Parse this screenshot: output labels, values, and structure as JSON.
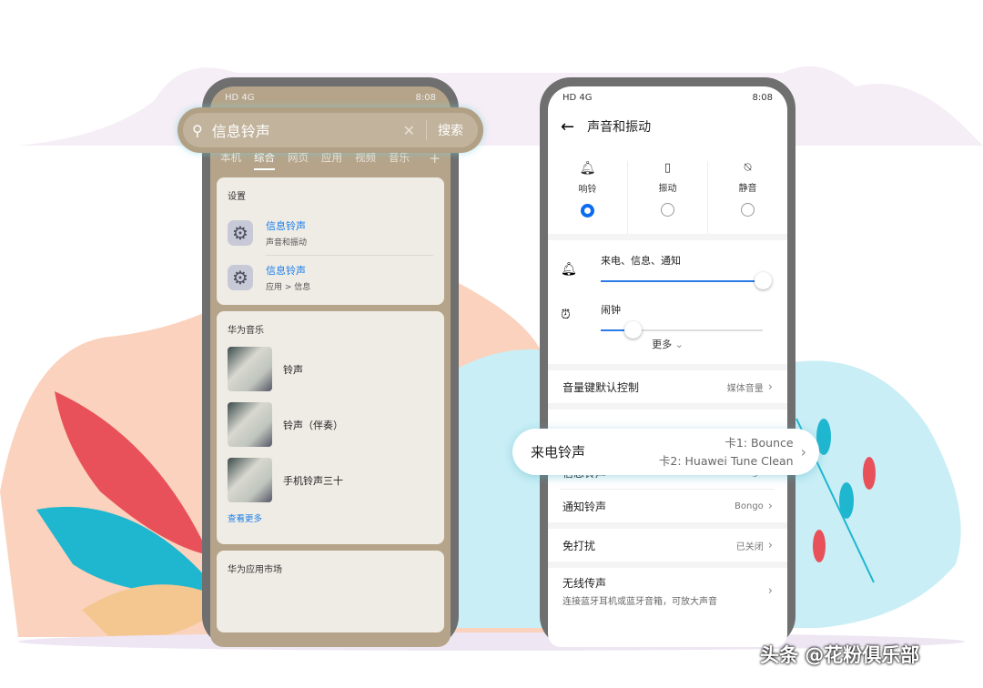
{
  "colors": {
    "accent": "#0a6cf0",
    "link": "#1a7ee8",
    "frame": "#6f6f6f",
    "search_bg": "#b5a48a"
  },
  "status": {
    "left": "HD 4G",
    "time": "8:08"
  },
  "search": {
    "query": "信息铃声",
    "button": "搜索",
    "tabs": [
      "本机",
      "综合",
      "网页",
      "应用",
      "视频",
      "音乐"
    ],
    "active_tab": "综合",
    "add": "+"
  },
  "settings_card": {
    "title": "设置",
    "results": [
      {
        "title": "信息铃声",
        "sub": "声音和振动"
      },
      {
        "title": "信息铃声",
        "sub": "应用 > 信息"
      }
    ]
  },
  "music_card": {
    "title": "华为音乐",
    "items": [
      "铃声",
      "铃声（伴奏）",
      "手机铃声三十"
    ],
    "more": "查看更多"
  },
  "appmarket_card": {
    "title": "华为应用市场"
  },
  "sound": {
    "title": "声音和振动",
    "modes": [
      {
        "label": "响铃",
        "icon": "bell-icon",
        "selected": true
      },
      {
        "label": "振动",
        "icon": "vibrate-icon",
        "selected": false
      },
      {
        "label": "静音",
        "icon": "bell-off-icon",
        "selected": false
      }
    ],
    "sliders": [
      {
        "label": "来电、信息、通知",
        "icon": "bell-icon",
        "level": 100
      },
      {
        "label": "闹钟",
        "icon": "alarm-icon",
        "level": 20
      }
    ],
    "more": "更多",
    "volume_key": {
      "label": "音量键默认控制",
      "value": "媒体音量"
    },
    "ringtone": {
      "label": "来电铃声",
      "card1": "卡1: Bounce",
      "card2": "卡2: Huawei Tune Clean"
    },
    "message": {
      "label": "信息铃声",
      "value": "Bongo"
    },
    "notify": {
      "label": "通知铃声",
      "value": "Bongo"
    },
    "dnd": {
      "label": "免打扰",
      "value": "已关闭"
    },
    "wireless": {
      "label": "无线传声",
      "sub": "连接蓝牙耳机或蓝牙音箱，可放大声音"
    }
  },
  "watermark": "头条 @花粉俱乐部"
}
